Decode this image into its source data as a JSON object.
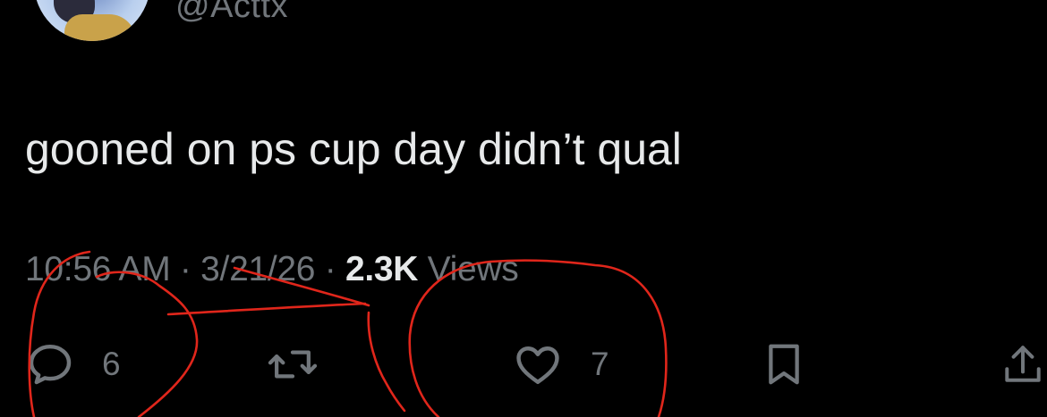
{
  "author": {
    "handle": "@Acttx"
  },
  "tweet": {
    "text": "gooned on ps cup day didn’t qual"
  },
  "meta": {
    "time": "10:56 AM",
    "separator": " · ",
    "date": "3/21/26",
    "views_count": "2.3K",
    "views_label": " Views"
  },
  "actions": {
    "reply_count": "6",
    "like_count": "7"
  },
  "icons": {
    "reply": "reply-icon",
    "retweet": "retweet-icon",
    "like": "like-icon",
    "bookmark": "bookmark-icon",
    "share": "share-icon"
  },
  "colors": {
    "background": "#000000",
    "text_primary": "#e7e9ea",
    "text_secondary": "#71767b",
    "annotation": "#e0261b"
  }
}
